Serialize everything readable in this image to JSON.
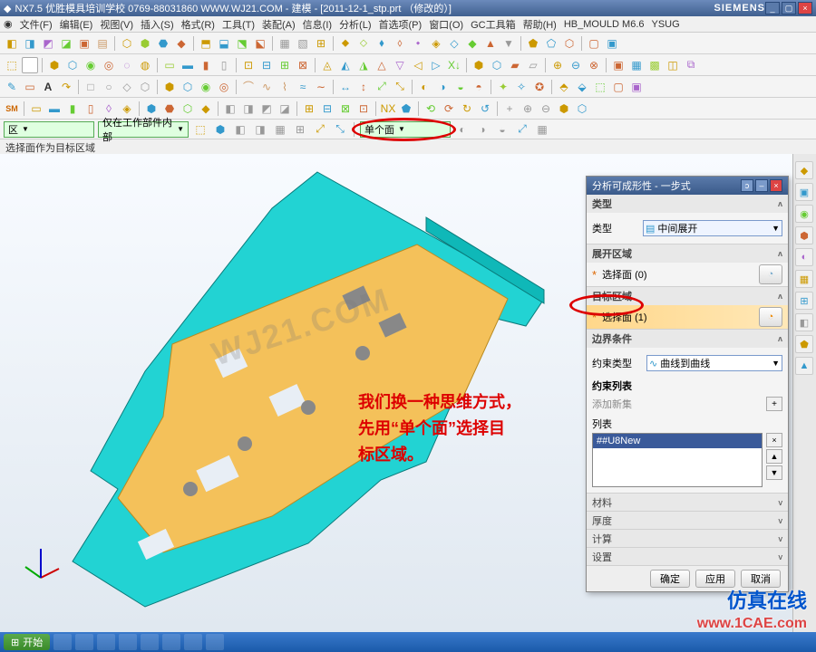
{
  "titlebar": {
    "app": "NX7.5",
    "org": "优胜模具培训学校",
    "phone": "0769-88031860",
    "site": "WWW.WJ21.COM",
    "doc": "建模 - [2011-12-1_stp.prt （修改的）]",
    "brand": "SIEMENS"
  },
  "menu": {
    "file": "文件(F)",
    "edit": "编辑(E)",
    "view": "视图(V)",
    "insert": "插入(S)",
    "format": "格式(R)",
    "tools": "工具(T)",
    "assembly": "装配(A)",
    "info": "信息(I)",
    "analysis": "分析(L)",
    "preferences": "首选项(P)",
    "window": "窗口(O)",
    "gc": "GC工具箱",
    "help": "帮助(H)",
    "hbmould": "HB_MOULD M6.6",
    "ysug": "YSUG"
  },
  "selectors": {
    "left": "区",
    "scope": "仅在工作部件内部",
    "facefilter": "单个面"
  },
  "status": "选择面作为目标区域",
  "dialog": {
    "title": "分析可成形性 - 一步式",
    "type_section": "类型",
    "type_label": "类型",
    "type_value": "中间展开",
    "unfold_section": "展开区域",
    "select_face_0": "选择面 (0)",
    "target_section": "目标区域",
    "select_face_1": "选择面 (1)",
    "boundary_section": "边界条件",
    "constraint_label": "约束类型",
    "constraint_value": "曲线到曲线",
    "constraint_list_h": "约束列表",
    "add_new": "添加新集",
    "list_h": "列表",
    "list_item": "##U8New",
    "material": "材料",
    "thickness": "厚度",
    "compute": "计算",
    "settings": "设置",
    "ok": "确定",
    "apply": "应用",
    "cancel": "取消"
  },
  "annotation": {
    "line1": "我们换一种思维方式，",
    "line2": "先用“单个面”选择目",
    "line3": "标区域。"
  },
  "watermarks": {
    "center": "WJ21.COM",
    "corner1": "仿真在线",
    "corner2": "www.1CAE.com"
  },
  "taskbar": {
    "start": "开始"
  }
}
